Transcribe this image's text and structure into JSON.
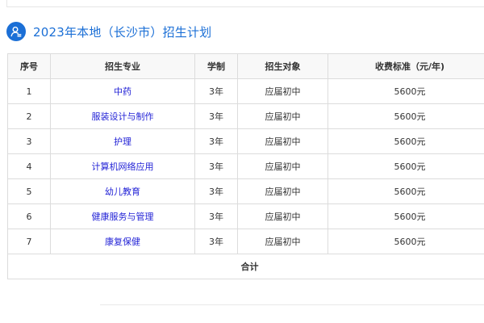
{
  "section": {
    "title": "2023年本地（长沙市）招生计划",
    "icon": "user-info-icon",
    "accent_color": "#1b6fd6"
  },
  "table": {
    "headers": [
      "序号",
      "招生专业",
      "学制",
      "招生对象",
      "收费标准（元/年)"
    ],
    "rows": [
      [
        "1",
        "中药",
        "3年",
        "应届初中",
        "5600元"
      ],
      [
        "2",
        "服装设计与制作",
        "3年",
        "应届初中",
        "5600元"
      ],
      [
        "3",
        "护理",
        "3年",
        "应届初中",
        "5600元"
      ],
      [
        "4",
        "计算机网络应用",
        "3年",
        "应届初中",
        "5600元"
      ],
      [
        "5",
        "幼儿教育",
        "3年",
        "应届初中",
        "5600元"
      ],
      [
        "6",
        "健康服务与管理",
        "3年",
        "应届初中",
        "5600元"
      ],
      [
        "7",
        "康复保健",
        "3年",
        "应届初中",
        "5600元"
      ]
    ],
    "total_label": "合计",
    "major_link_color": "#2323d6"
  }
}
